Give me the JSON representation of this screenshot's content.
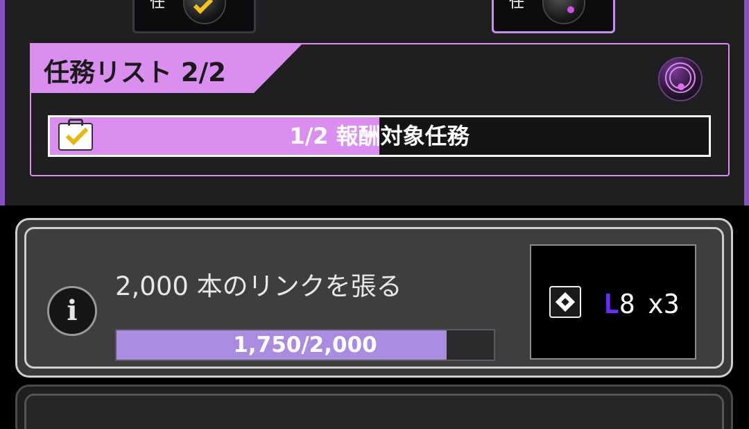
{
  "top_tabs": {
    "left_partial_text": "任",
    "right_partial_text": "任"
  },
  "mission_list": {
    "title": "任務リスト 2/2",
    "reward_bar": {
      "label": "1/2 報酬対象任務",
      "progress_fraction": 0.5
    }
  },
  "task": {
    "title": "2,000 本のリンクを張る",
    "progress_label": "1,750/2,000",
    "progress_fraction": 0.875,
    "reward": {
      "level_prefix": "L",
      "level_number": "8",
      "quantity": "x3"
    }
  },
  "next_task": {
    "title": ""
  },
  "colors": {
    "accent": "#d98ef0",
    "progress_fill": "#a98be0",
    "level_prefix": "#6a2cff",
    "checkmark": "#f2c31b"
  }
}
